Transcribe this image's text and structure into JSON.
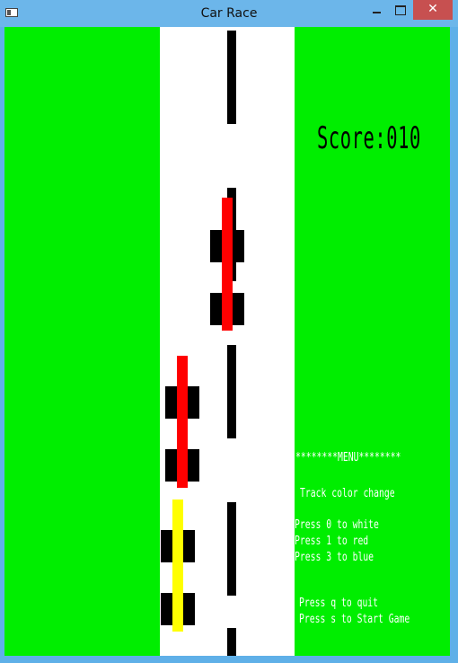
{
  "window": {
    "title": "Car Race",
    "close_glyph": "✕"
  },
  "game": {
    "score_text": "Score:010",
    "colors": {
      "grass": "#00ee00",
      "track": "#ffffff",
      "lane_marker": "#000000",
      "enemy_car": "#ff0000",
      "player_car": "#ffff00"
    }
  },
  "menu": {
    "heading": "********MENU********",
    "track_color": "Track color change",
    "option_white": "Press 0 to white",
    "option_red": "Press 1 to red",
    "option_blue": "Press 3 to blue",
    "quit": "Press q to quit",
    "start": "Press s to Start Game"
  }
}
